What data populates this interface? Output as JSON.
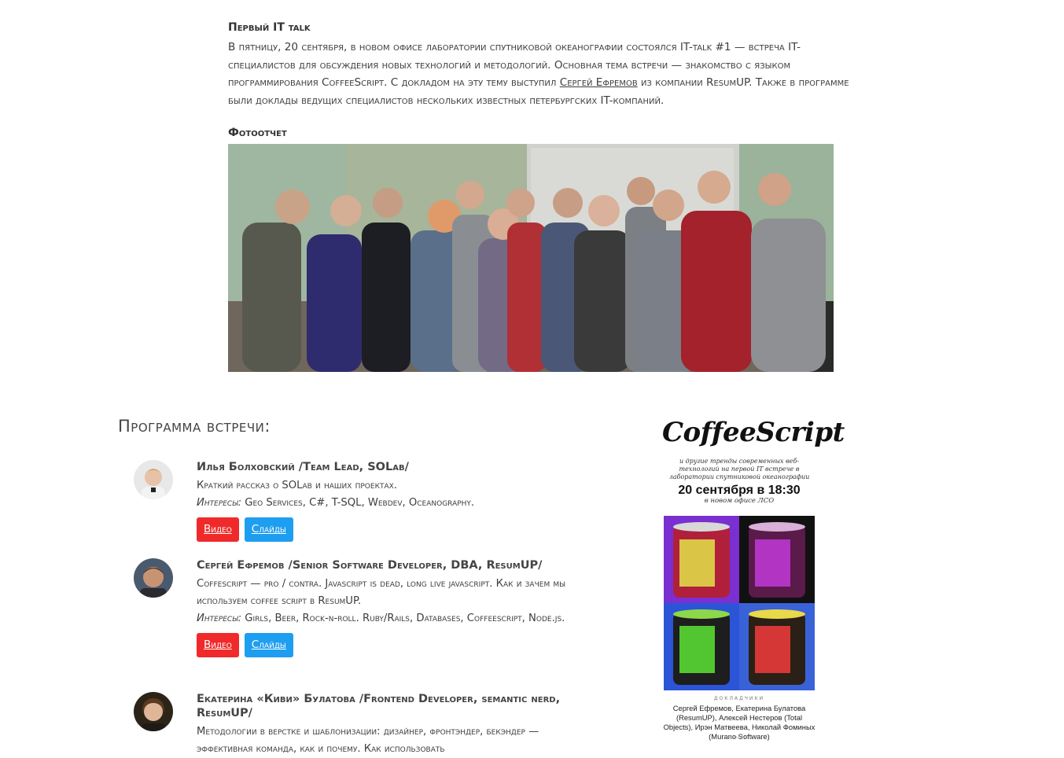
{
  "intro": {
    "title": "Первый IT talk",
    "text_before_link": "В пятницу, 20 сентября, в новом офисе лаборатории спутниковой океанографии состоялся IT-talk #1 — встреча IT-специалистов для обсуждения новых технологий и методологий. Основная тема встречи — знакомство с языком программирования CoffeeScript. С докладом на эту тему выступил ",
    "link_text": "Сергей Ефремов",
    "text_after_link": " из компании ResumUP. Также в программе были доклады ведущих специалистов нескольких известных петербургских IT-компаний."
  },
  "photo_section": {
    "title": "Фотоотчет"
  },
  "program": {
    "title": "Программа встречи:",
    "speakers": [
      {
        "name": "Илья Болховский /Team Lead, SOLab/",
        "description": "Краткий рассказ о SOLab и наших проектах.",
        "interests_label": "Интересы:",
        "interests": " Geo Services, C#, T-SQL, Webdev, Oceanography.",
        "video_label": "Видео",
        "slides_label": "Слайды"
      },
      {
        "name": "Сергей Ефремов /Senior Software Developer, DBA, ResumUP/",
        "description": "Coffescript — pro / contra. Javascript is dead, long live javascript. Как и зачем мы используем coffee script в ResumUP.",
        "interests_label": "Интересы:",
        "interests": " Girls, Beer, Rock-n-roll. Ruby/Rails, Databases, Coffeescript, Node.js.",
        "video_label": "Видео",
        "slides_label": "Слайды"
      },
      {
        "name": "Екатерина «Киви» Булатова /Frontend Developer, semantic nerd, ResumUP/",
        "description": "Методологии в верстке и шаблонизации: дизайнер, фронтэндер, бекэндер — эффективная команда, как и почему. Как использовать"
      }
    ]
  },
  "poster": {
    "title": "CoffeeScript",
    "subtitle": "и другие тренды современных веб-технологий на первой IT встрече в лаборатории спутниковой океанографии",
    "date": "20 сентября в 18:30",
    "place": "в новом офисе ЛСО",
    "speakers_label": "ДОКЛАДЧИКИ",
    "speakers_names": "Сергей Ефремов, Екатерина Булатова (ResumUP), Алексей Нестеров (Total Objects), Ирэн Матвеева, Николай Фоминых (Murano Software)",
    "url": "solab.rshu.ru",
    "colors": {
      "tl_bg": "#7a2fd0",
      "tr_bg": "#c52ad0",
      "bl_bg": "#2b55d6",
      "br_bg": "#d02a7a"
    }
  }
}
